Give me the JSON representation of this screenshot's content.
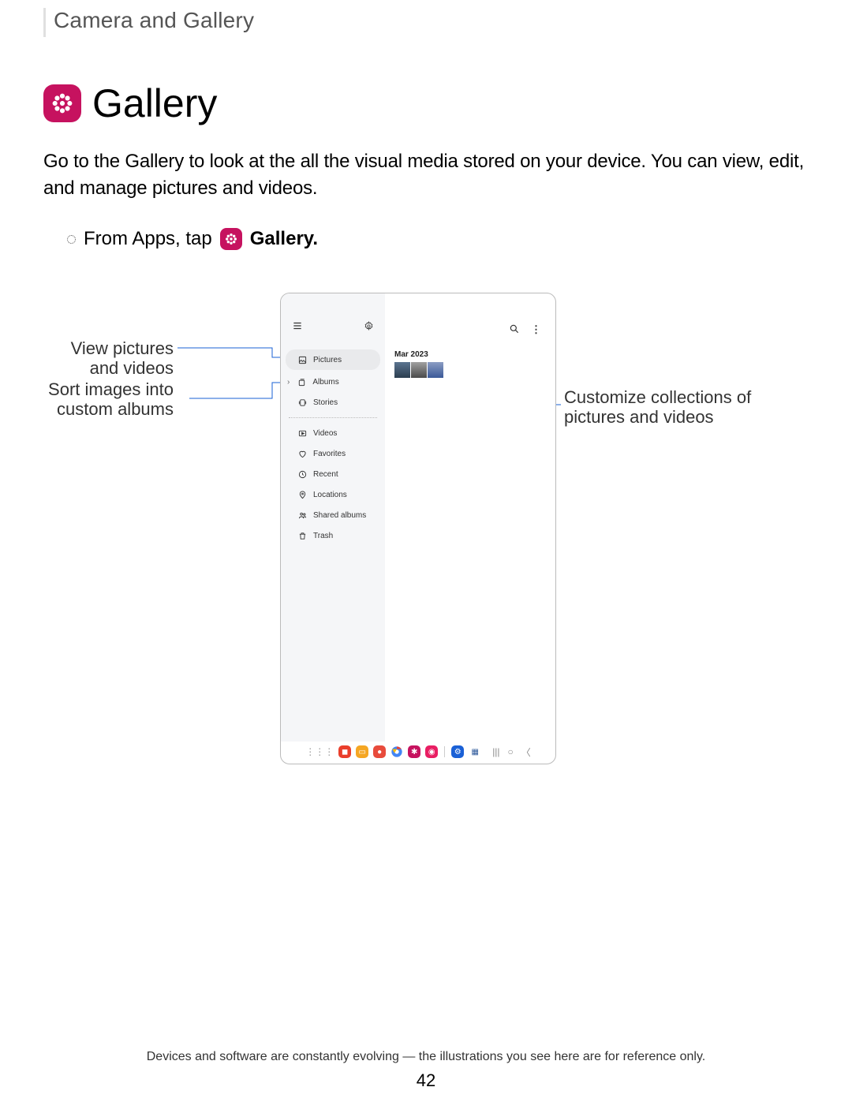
{
  "header": {
    "section": "Camera and Gallery"
  },
  "title": "Gallery",
  "description": "Go to the Gallery to look at the all the visual media stored on your device. You can view, edit, and manage pictures and videos.",
  "instruction": {
    "lead": "From Apps, tap",
    "app_name": "Gallery."
  },
  "callouts": {
    "view": "View pictures and videos",
    "sort": "Sort images into custom albums",
    "customize": "Customize collections of pictures and videos"
  },
  "device": {
    "content_date": "Mar 2023",
    "sidebar": {
      "items": [
        {
          "label": "Pictures",
          "icon": "image-icon"
        },
        {
          "label": "Albums",
          "icon": "albums-icon"
        },
        {
          "label": "Stories",
          "icon": "stories-icon"
        },
        {
          "label": "Videos",
          "icon": "video-icon"
        },
        {
          "label": "Favorites",
          "icon": "heart-icon"
        },
        {
          "label": "Recent",
          "icon": "clock-icon"
        },
        {
          "label": "Locations",
          "icon": "pin-icon"
        },
        {
          "label": "Shared albums",
          "icon": "shared-icon"
        },
        {
          "label": "Trash",
          "icon": "trash-icon"
        }
      ]
    }
  },
  "footer": {
    "disclaimer": "Devices and software are constantly evolving — the illustrations you see here are for reference only.",
    "page_number": "42"
  }
}
